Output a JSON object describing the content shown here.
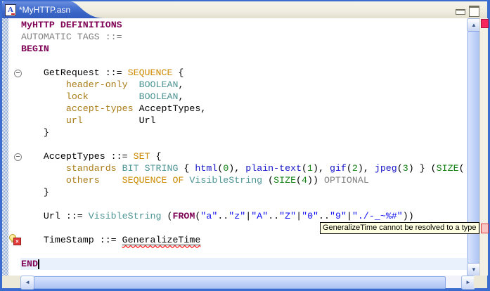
{
  "tab_bar": {
    "tab_title": "*MyHTTP.asn",
    "close_label": "✕",
    "file_icon_letter": "A"
  },
  "window_controls": {
    "minimize_icon": "minimize-icon",
    "maximize_icon": "maximize-icon"
  },
  "tooltip": {
    "text": "GeneralizeTime cannot be resolved to a type",
    "background": "#FFFFE1"
  },
  "scrollbar_icons": {
    "up": "▲",
    "down": "▼",
    "left": "◄",
    "right": "►"
  },
  "error_marker": {
    "x_label": "×"
  },
  "colors": {
    "keyword": "#7F0055",
    "type_keyword": "#CC8A00",
    "field_name": "#A97B16",
    "builtin_type": "#4D9494",
    "named_value": "#1414C8",
    "string": "#0A0AF0",
    "number": "#0F7F0F",
    "grayed": "#808080",
    "tab_blue": "#3A64C4",
    "current_line": "#E9F2FC",
    "error_squiggle": "#FF2A2A"
  },
  "editor": {
    "lines": [
      [
        {
          "t": "MyHTTP",
          "c": "kw"
        },
        {
          "t": " ",
          "c": "plain"
        },
        {
          "t": "DEFINITIONS",
          "c": "kw"
        }
      ],
      [
        {
          "t": "AUTOMATIC TAGS ::=",
          "c": "gray"
        }
      ],
      [
        {
          "t": "BEGIN",
          "c": "kw"
        }
      ],
      [],
      [
        {
          "t": "    GetRequest ::= ",
          "c": "plain"
        },
        {
          "t": "SEQUENCE",
          "c": "tkw"
        },
        {
          "t": " {",
          "c": "plain"
        }
      ],
      [
        {
          "t": "        ",
          "c": "plain"
        },
        {
          "t": "header-only",
          "c": "field"
        },
        {
          "t": "  ",
          "c": "plain"
        },
        {
          "t": "BOOLEAN",
          "c": "btype"
        },
        {
          "t": ",",
          "c": "plain"
        }
      ],
      [
        {
          "t": "        ",
          "c": "plain"
        },
        {
          "t": "lock",
          "c": "field"
        },
        {
          "t": "         ",
          "c": "plain"
        },
        {
          "t": "BOOLEAN",
          "c": "btype"
        },
        {
          "t": ",",
          "c": "plain"
        }
      ],
      [
        {
          "t": "        ",
          "c": "plain"
        },
        {
          "t": "accept-types",
          "c": "field"
        },
        {
          "t": " ",
          "c": "plain"
        },
        {
          "t": "AcceptTypes,",
          "c": "plain"
        }
      ],
      [
        {
          "t": "        ",
          "c": "plain"
        },
        {
          "t": "url",
          "c": "field"
        },
        {
          "t": "          ",
          "c": "plain"
        },
        {
          "t": "Url",
          "c": "plain"
        }
      ],
      [
        {
          "t": "    }",
          "c": "plain"
        }
      ],
      [],
      [
        {
          "t": "    AcceptTypes ::= ",
          "c": "plain"
        },
        {
          "t": "SET",
          "c": "tkw"
        },
        {
          "t": " {",
          "c": "plain"
        }
      ],
      [
        {
          "t": "        ",
          "c": "plain"
        },
        {
          "t": "standards",
          "c": "field"
        },
        {
          "t": " ",
          "c": "plain"
        },
        {
          "t": "BIT STRING",
          "c": "btype"
        },
        {
          "t": " { ",
          "c": "plain"
        },
        {
          "t": "html",
          "c": "val"
        },
        {
          "t": "(",
          "c": "plain"
        },
        {
          "t": "0",
          "c": "num"
        },
        {
          "t": "), ",
          "c": "plain"
        },
        {
          "t": "plain-text",
          "c": "val"
        },
        {
          "t": "(",
          "c": "plain"
        },
        {
          "t": "1",
          "c": "num"
        },
        {
          "t": "), ",
          "c": "plain"
        },
        {
          "t": "gif",
          "c": "val"
        },
        {
          "t": "(",
          "c": "plain"
        },
        {
          "t": "2",
          "c": "num"
        },
        {
          "t": "), ",
          "c": "plain"
        },
        {
          "t": "jpeg",
          "c": "val"
        },
        {
          "t": "(",
          "c": "plain"
        },
        {
          "t": "3",
          "c": "num"
        },
        {
          "t": ") } (",
          "c": "plain"
        },
        {
          "t": "SIZE",
          "c": "num"
        },
        {
          "t": "(",
          "c": "plain"
        }
      ],
      [
        {
          "t": "        ",
          "c": "plain"
        },
        {
          "t": "others",
          "c": "field"
        },
        {
          "t": "    ",
          "c": "plain"
        },
        {
          "t": "SEQUENCE OF",
          "c": "tkw"
        },
        {
          "t": " ",
          "c": "plain"
        },
        {
          "t": "VisibleString",
          "c": "btype"
        },
        {
          "t": " (",
          "c": "plain"
        },
        {
          "t": "SIZE",
          "c": "num"
        },
        {
          "t": "(",
          "c": "plain"
        },
        {
          "t": "4",
          "c": "num"
        },
        {
          "t": ")) ",
          "c": "plain"
        },
        {
          "t": "OPTIONAL",
          "c": "gray"
        }
      ],
      [
        {
          "t": "    }",
          "c": "plain"
        }
      ],
      [],
      [
        {
          "t": "    Url ::= ",
          "c": "plain"
        },
        {
          "t": "VisibleString",
          "c": "btype"
        },
        {
          "t": " (",
          "c": "plain"
        },
        {
          "t": "FROM",
          "c": "kw"
        },
        {
          "t": "(",
          "c": "plain"
        },
        {
          "t": "\"a\"",
          "c": "str"
        },
        {
          "t": "..",
          "c": "plain"
        },
        {
          "t": "\"z\"",
          "c": "str"
        },
        {
          "t": "|",
          "c": "plain"
        },
        {
          "t": "\"A\"",
          "c": "str"
        },
        {
          "t": "..",
          "c": "plain"
        },
        {
          "t": "\"Z\"",
          "c": "str"
        },
        {
          "t": "|",
          "c": "plain"
        },
        {
          "t": "\"0\"",
          "c": "str"
        },
        {
          "t": "..",
          "c": "plain"
        },
        {
          "t": "\"9\"",
          "c": "str"
        },
        {
          "t": "|",
          "c": "plain"
        },
        {
          "t": "\"./-_~%#\"",
          "c": "str"
        },
        {
          "t": "))",
          "c": "plain"
        }
      ],
      [],
      [
        {
          "t": "    TimeStamp ::= ",
          "c": "plain"
        },
        {
          "t": "GeneralizeTime",
          "c": "err"
        }
      ],
      [],
      [
        {
          "t": "END",
          "c": "kw"
        }
      ]
    ]
  }
}
